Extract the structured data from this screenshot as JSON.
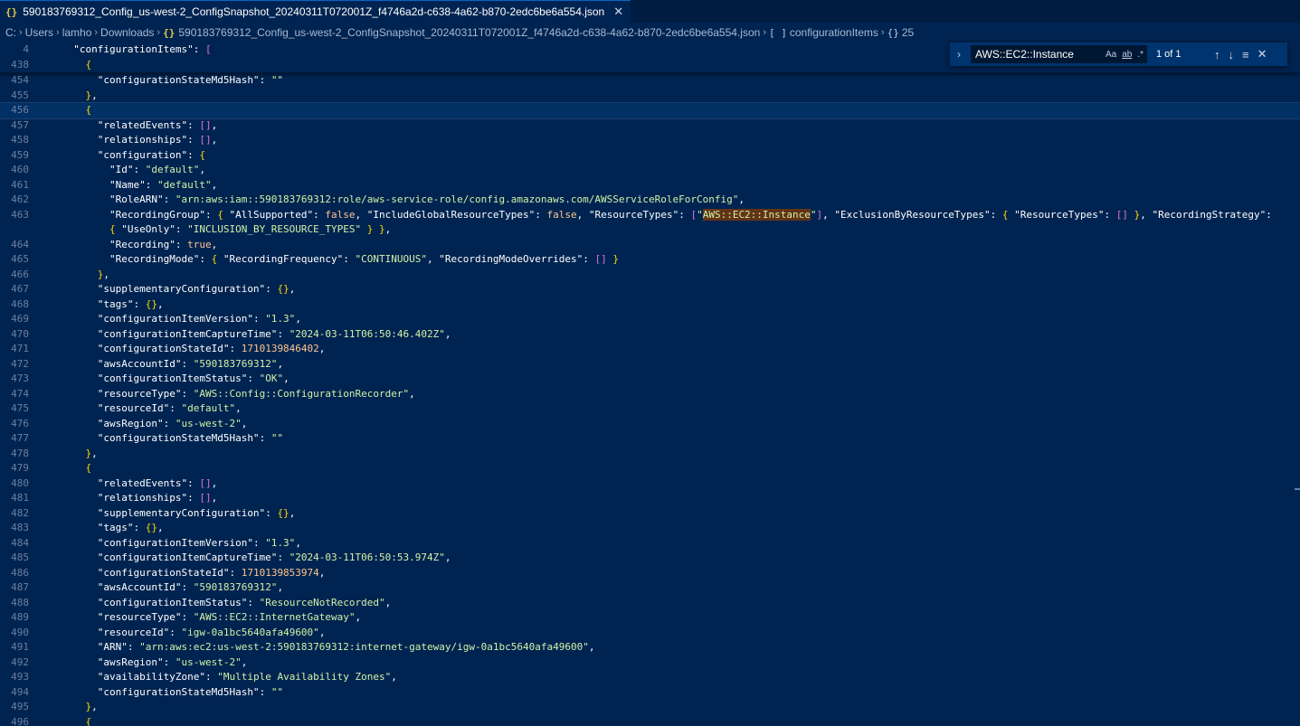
{
  "tab": {
    "icon": "{}",
    "title": "590183769312_Config_us-west-2_ConfigSnapshot_20240311T072001Z_f4746a2d-c638-4a62-b870-2edc6be6a554.json",
    "close": "✕"
  },
  "breadcrumb": {
    "items": [
      "C:",
      "Users",
      "lamho",
      "Downloads"
    ],
    "file_icon": "{}",
    "file": "590183769312_Config_us-west-2_ConfigSnapshot_20240311T072001Z_f4746a2d-c638-4a62-b870-2edc6be6a554.json",
    "array_icon": "[ ]",
    "array": "configurationItems",
    "object_icon": "{}",
    "object": "25"
  },
  "find": {
    "query": "AWS::EC2::Instance",
    "match_case": "Aa",
    "whole_word": "ab",
    "regex": ".*",
    "count": "1 of 1",
    "prev": "↑",
    "next": "↓",
    "selection": "≡",
    "close": "✕",
    "toggle": "›"
  },
  "icons": {
    "json": "braces-icon",
    "close": "close-icon",
    "chevron": "chevron-right-icon"
  },
  "lines": [
    {
      "n": "4",
      "text": "  \"configurationItems\": [",
      "sticky": true
    },
    {
      "n": "438",
      "text": "    {",
      "sticky": true
    },
    {
      "n": "454",
      "text": "      \"configurationStateMd5Hash\": \"\""
    },
    {
      "n": "455",
      "text": "    },"
    },
    {
      "n": "456",
      "text": "    {",
      "current": true
    },
    {
      "n": "457",
      "text": "      \"relatedEvents\": [],"
    },
    {
      "n": "458",
      "text": "      \"relationships\": [],"
    },
    {
      "n": "459",
      "text": "      \"configuration\": {"
    },
    {
      "n": "460",
      "text": "        \"Id\": \"default\","
    },
    {
      "n": "461",
      "text": "        \"Name\": \"default\","
    },
    {
      "n": "462",
      "text": "        \"RoleARN\": \"arn:aws:iam::590183769312:role/aws-service-role/config.amazonaws.com/AWSServiceRoleForConfig\","
    },
    {
      "n": "463",
      "text": "        \"RecordingGroup\": { \"AllSupported\": false, \"IncludeGlobalResourceTypes\": false, \"ResourceTypes\": [\"AWS::EC2::Instance\"], \"ExclusionByResourceTypes\": { \"ResourceTypes\": [] }, \"RecordingStrategy\":"
    },
    {
      "n": "",
      "text": "        { \"UseOnly\": \"INCLUSION_BY_RESOURCE_TYPES\" } },"
    },
    {
      "n": "464",
      "text": "        \"Recording\": true,"
    },
    {
      "n": "465",
      "text": "        \"RecordingMode\": { \"RecordingFrequency\": \"CONTINUOUS\", \"RecordingModeOverrides\": [] }"
    },
    {
      "n": "466",
      "text": "      },"
    },
    {
      "n": "467",
      "text": "      \"supplementaryConfiguration\": {},"
    },
    {
      "n": "468",
      "text": "      \"tags\": {},"
    },
    {
      "n": "469",
      "text": "      \"configurationItemVersion\": \"1.3\","
    },
    {
      "n": "470",
      "text": "      \"configurationItemCaptureTime\": \"2024-03-11T06:50:46.402Z\","
    },
    {
      "n": "471",
      "text": "      \"configurationStateId\": 1710139846402,"
    },
    {
      "n": "472",
      "text": "      \"awsAccountId\": \"590183769312\","
    },
    {
      "n": "473",
      "text": "      \"configurationItemStatus\": \"OK\","
    },
    {
      "n": "474",
      "text": "      \"resourceType\": \"AWS::Config::ConfigurationRecorder\","
    },
    {
      "n": "475",
      "text": "      \"resourceId\": \"default\","
    },
    {
      "n": "476",
      "text": "      \"awsRegion\": \"us-west-2\","
    },
    {
      "n": "477",
      "text": "      \"configurationStateMd5Hash\": \"\""
    },
    {
      "n": "478",
      "text": "    },"
    },
    {
      "n": "479",
      "text": "    {"
    },
    {
      "n": "480",
      "text": "      \"relatedEvents\": [],"
    },
    {
      "n": "481",
      "text": "      \"relationships\": [],"
    },
    {
      "n": "482",
      "text": "      \"supplementaryConfiguration\": {},"
    },
    {
      "n": "483",
      "text": "      \"tags\": {},"
    },
    {
      "n": "484",
      "text": "      \"configurationItemVersion\": \"1.3\","
    },
    {
      "n": "485",
      "text": "      \"configurationItemCaptureTime\": \"2024-03-11T06:50:53.974Z\","
    },
    {
      "n": "486",
      "text": "      \"configurationStateId\": 1710139853974,"
    },
    {
      "n": "487",
      "text": "      \"awsAccountId\": \"590183769312\","
    },
    {
      "n": "488",
      "text": "      \"configurationItemStatus\": \"ResourceNotRecorded\","
    },
    {
      "n": "489",
      "text": "      \"resourceType\": \"AWS::EC2::InternetGateway\","
    },
    {
      "n": "490",
      "text": "      \"resourceId\": \"igw-0a1bc5640afa49600\","
    },
    {
      "n": "491",
      "text": "      \"ARN\": \"arn:aws:ec2:us-west-2:590183769312:internet-gateway/igw-0a1bc5640afa49600\","
    },
    {
      "n": "492",
      "text": "      \"awsRegion\": \"us-west-2\","
    },
    {
      "n": "493",
      "text": "      \"availabilityZone\": \"Multiple Availability Zones\","
    },
    {
      "n": "494",
      "text": "      \"configurationStateMd5Hash\": \"\""
    },
    {
      "n": "495",
      "text": "    },"
    },
    {
      "n": "496",
      "text": "    {"
    }
  ]
}
